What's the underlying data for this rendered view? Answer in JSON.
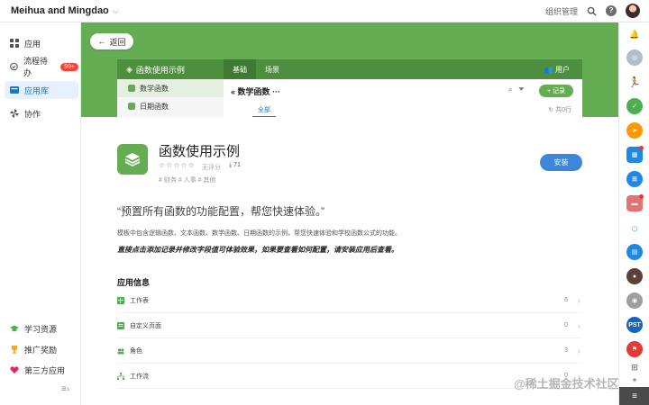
{
  "topbar": {
    "org_name": "Meihua and Mingdao",
    "menu_text": "组织管理",
    "help_label": "?"
  },
  "sidebar": {
    "items": [
      {
        "label": "应用",
        "icon": "grid-icon"
      },
      {
        "label": "流程待办",
        "icon": "check-circle-icon",
        "badge": "99+"
      },
      {
        "label": "应用库",
        "icon": "library-icon"
      },
      {
        "label": "协作",
        "icon": "pinwheel-icon"
      }
    ],
    "bottom_items": [
      {
        "label": "学习资源",
        "icon": "graduation-cap-icon"
      },
      {
        "label": "推广奖励",
        "icon": "trophy-icon"
      },
      {
        "label": "第三方应用",
        "icon": "heart-icon"
      }
    ]
  },
  "hero": {
    "back_label": "返回",
    "preview": {
      "app_name": "函数使用示例",
      "tabs": [
        "基础",
        "场景"
      ],
      "user_label": "用户",
      "side_items": [
        "数学函数",
        "日期函数"
      ],
      "sheet_title": "数学函数",
      "add_label": "+ 记录",
      "filter_label": "全部",
      "count_label": "共0行"
    }
  },
  "app": {
    "title": "函数使用示例",
    "stars": "☆☆☆☆☆",
    "rating_text": "无评分",
    "installs": "71",
    "tags": "# 财务  # 人事  # 其他",
    "install_label": "安装",
    "quote": "“预置所有函数的功能配置，帮您快速体验。”",
    "description": "模板中包含逻辑函数、文本函数、数学函数、日期函数的示例，帮您快速体验和学校函数公式的功能。",
    "tip": "直接点击添加记录并修改字段值可体验效果，如果要查看如何配置，请安装应用后查看。",
    "info_title": "应用信息",
    "info_rows": [
      {
        "label": "工作表",
        "count": "6",
        "icon": "sheet-icon",
        "color": "#4caf50"
      },
      {
        "label": "自定义页面",
        "count": "0",
        "icon": "page-icon",
        "color": "#4caf50"
      },
      {
        "label": "角色",
        "count": "3",
        "icon": "role-icon",
        "color": "#4caf50"
      },
      {
        "label": "工作流",
        "count": "0",
        "icon": "workflow-icon",
        "color": "#4caf50"
      }
    ]
  },
  "dock": {
    "items": [
      {
        "icon": "bell-icon",
        "color": "#9e9e9e",
        "text": ""
      },
      {
        "icon": "group-icon",
        "color": "#b0bec5",
        "text": ""
      },
      {
        "icon": "runner-icon",
        "color": "#ffffff",
        "text": ""
      },
      {
        "icon": "check-app-icon",
        "color": "#4caf50",
        "text": ""
      },
      {
        "icon": "send-icon",
        "color": "#ff9800",
        "text": ""
      },
      {
        "icon": "grid-app-icon",
        "color": "#1e88e5",
        "text": ""
      },
      {
        "icon": "tree-icon",
        "color": "#1e88e5",
        "text": ""
      },
      {
        "icon": "map-icon",
        "color": "#e57373",
        "text": ""
      },
      {
        "icon": "ring-icon",
        "color": "#42a5f5",
        "text": ""
      },
      {
        "icon": "chat-icon",
        "color": "#1e88e5",
        "text": ""
      },
      {
        "icon": "photo-icon",
        "color": "#5d4037",
        "text": ""
      },
      {
        "icon": "bubble-icon",
        "color": "#9e9e9e",
        "text": ""
      },
      {
        "icon": "pst-icon",
        "color": "#1565c0",
        "text": "PST"
      },
      {
        "icon": "flag-icon",
        "color": "#e53935",
        "text": ""
      }
    ],
    "bottom_label": "≡"
  },
  "watermark": "@稀土掘金技术社区"
}
